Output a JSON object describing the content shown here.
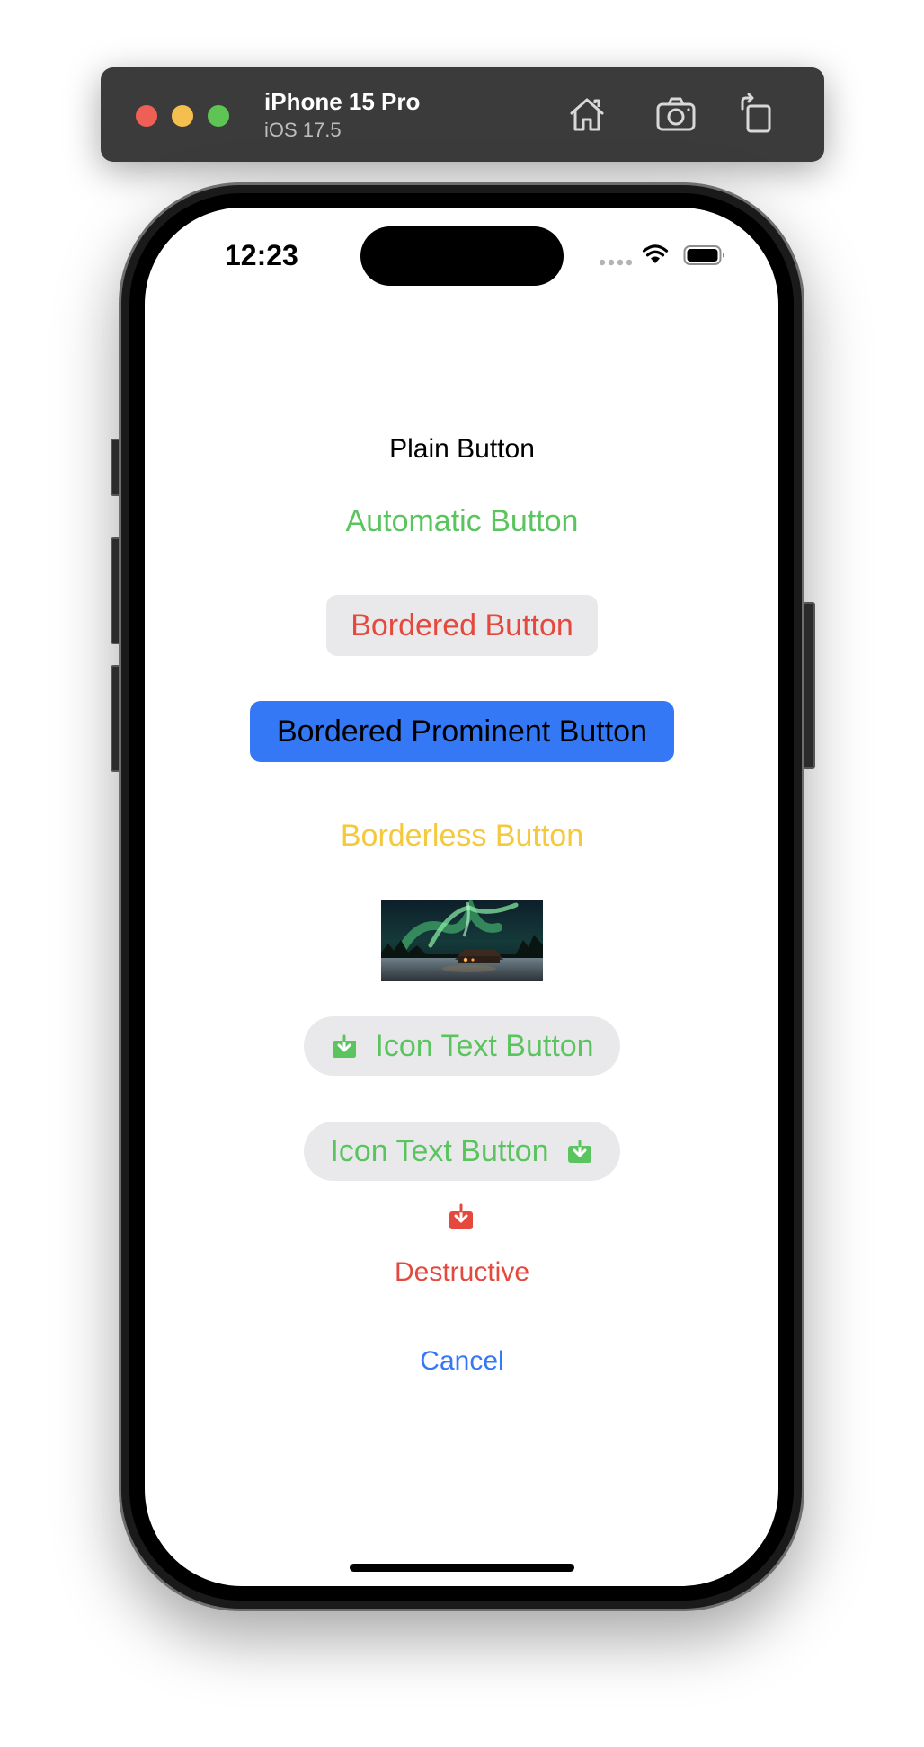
{
  "simulator": {
    "device_name": "iPhone 15 Pro",
    "os_version": "iOS 17.5",
    "toolbar_icons": [
      "home-icon",
      "screenshot-icon",
      "rotate-icon"
    ],
    "traffic_light_colors": {
      "close": "#ee5f56",
      "minimize": "#f4bf4f",
      "zoom": "#5ec453"
    }
  },
  "status_bar": {
    "time": "12:23",
    "icons": [
      "signal-icon",
      "wifi-icon",
      "battery-icon"
    ]
  },
  "buttons": {
    "plain": "Plain Button",
    "automatic": "Automatic Button",
    "bordered": "Bordered Button",
    "bordered_prominent": "Bordered Prominent Button",
    "borderless": "Borderless Button",
    "image_button": {
      "icon": "aurora-photo",
      "description": ""
    },
    "icon_text_leading": {
      "label": "Icon Text Button",
      "icon": "download-icon"
    },
    "icon_text_trailing": {
      "label": "Icon Text Button",
      "icon": "download-icon"
    },
    "destructive": {
      "label": "Destructive",
      "icon": "download-icon"
    },
    "cancel": "Cancel"
  },
  "colors": {
    "green": "#5ac45f",
    "red": "#e5493d",
    "blue": "#3478f6",
    "yellow": "#f4c93b",
    "bordered_bg": "#e9e9eb"
  }
}
